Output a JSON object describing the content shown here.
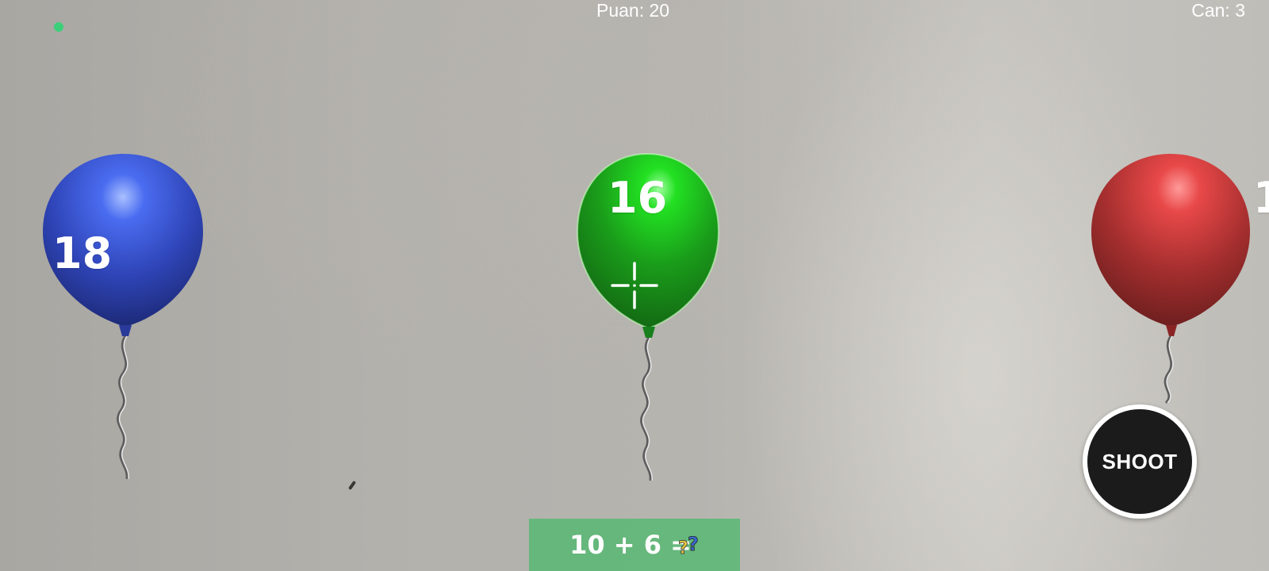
{
  "hud": {
    "score_text": "Puan: 20",
    "lives_text": "Can: 3",
    "status_dot_color": "#3ccf7a"
  },
  "balloons": [
    {
      "color": "#3650d8",
      "number": "18"
    },
    {
      "color": "#1ec01e",
      "number": "16"
    },
    {
      "color": "#c93636",
      "number": "1"
    }
  ],
  "crosshair": {
    "icon": "crosshair-icon"
  },
  "shoot_button": {
    "label": "SHOOT"
  },
  "question": {
    "text": "10 + 6 =",
    "icon": "question-marks-icon"
  }
}
